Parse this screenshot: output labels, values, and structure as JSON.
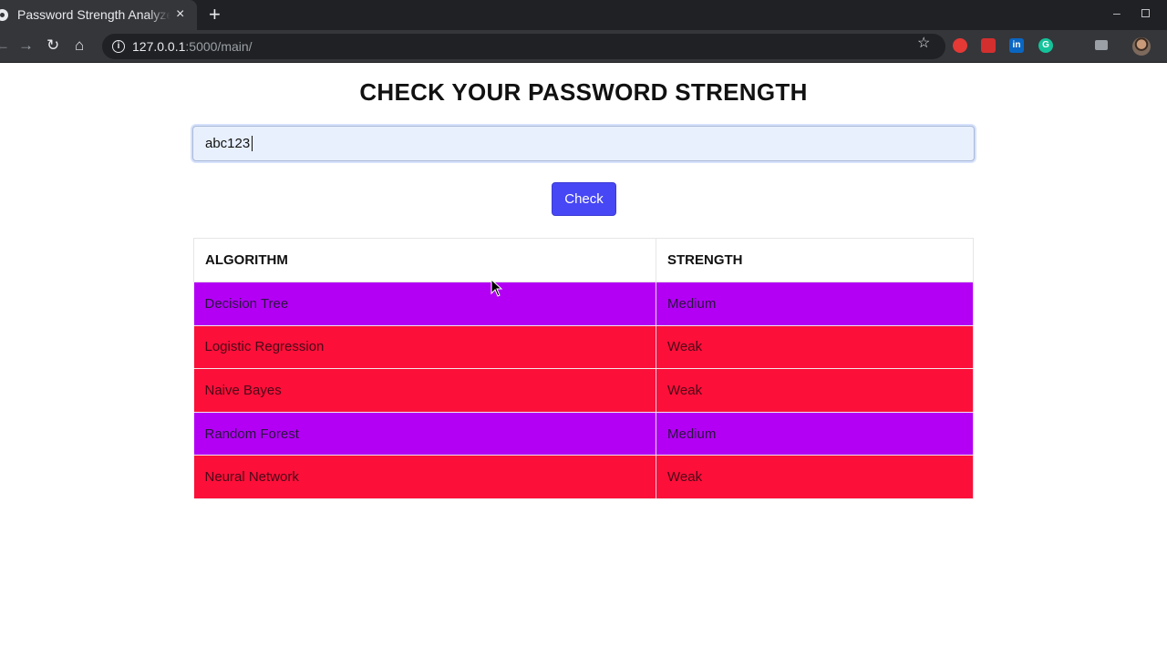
{
  "browser": {
    "tab_title": "Password Strength Analyzer",
    "tab_close": "×",
    "new_tab": "+",
    "url_host": "127.0.0.1",
    "url_rest": ":5000/main/"
  },
  "page": {
    "title": "CHECK YOUR PASSWORD STRENGTH",
    "password_value": "abc123",
    "check_label": "Check"
  },
  "table": {
    "headers": [
      "ALGORITHM",
      "STRENGTH"
    ],
    "rows": [
      {
        "algorithm": "Decision Tree",
        "strength": "Medium"
      },
      {
        "algorithm": "Logistic Regression",
        "strength": "Weak"
      },
      {
        "algorithm": "Naive Bayes",
        "strength": "Weak"
      },
      {
        "algorithm": "Random Forest",
        "strength": "Medium"
      },
      {
        "algorithm": "Neural Network",
        "strength": "Weak"
      }
    ]
  },
  "colors": {
    "medium": "#b300f5",
    "weak": "#fc0f39",
    "button": "#4747f5"
  }
}
